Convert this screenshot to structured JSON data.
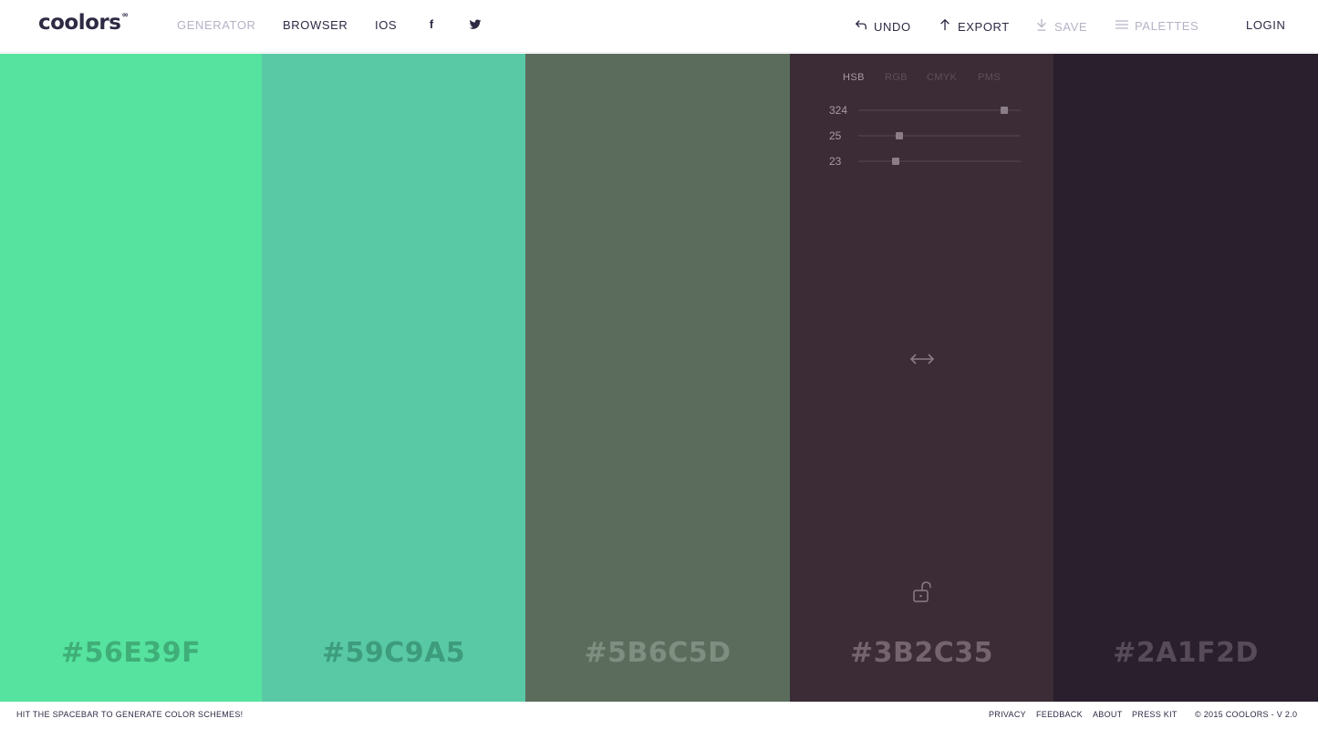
{
  "header": {
    "logo": "coolors",
    "logo_sup": "∞",
    "nav": {
      "generator": "GENERATOR",
      "browser": "BROWSER",
      "ios": "IOS"
    },
    "social": {
      "facebook": "f"
    },
    "actions": {
      "undo": "UNDO",
      "export": "EXPORT",
      "save": "SAVE",
      "palettes": "PALETTES",
      "login": "LOGIN"
    }
  },
  "palette": {
    "swatches": [
      {
        "hex": "#56E39F",
        "bg": "#56E39F",
        "text_color": "#3fae78"
      },
      {
        "hex": "#59C9A5",
        "bg": "#59C9A5",
        "text_color": "#3d9c7c"
      },
      {
        "hex": "#5B6C5D",
        "bg": "#5B6C5D",
        "text_color": "#7e8e80"
      },
      {
        "hex": "#3B2C35",
        "bg": "#3B2C35",
        "text_color": "#75646e"
      },
      {
        "hex": "#2A1F2D",
        "bg": "#2A1F2D",
        "text_color": "#574b5a"
      }
    ],
    "selected": {
      "modes": [
        "HSB",
        "RGB",
        "CMYK",
        "PMS"
      ],
      "active_mode": "HSB",
      "sliders": [
        {
          "value": "324",
          "fraction": 0.9
        },
        {
          "value": "25",
          "fraction": 0.25
        },
        {
          "value": "23",
          "fraction": 0.23
        }
      ]
    }
  },
  "footer": {
    "hint": "HIT THE SPACEBAR TO GENERATE COLOR SCHEMES!",
    "links": {
      "privacy": "PRIVACY",
      "feedback": "FEEDBACK",
      "about": "ABOUT",
      "press_kit": "PRESS KIT"
    },
    "copyright": "© 2015 COOLORS - V 2.0"
  },
  "colors": {
    "brand": "#2e2a44",
    "nav_dim": "#b6b2c6",
    "mode_active": "#a99aa3",
    "mode_inactive": "#5e4f58",
    "control_icon": "#8a7b85"
  }
}
